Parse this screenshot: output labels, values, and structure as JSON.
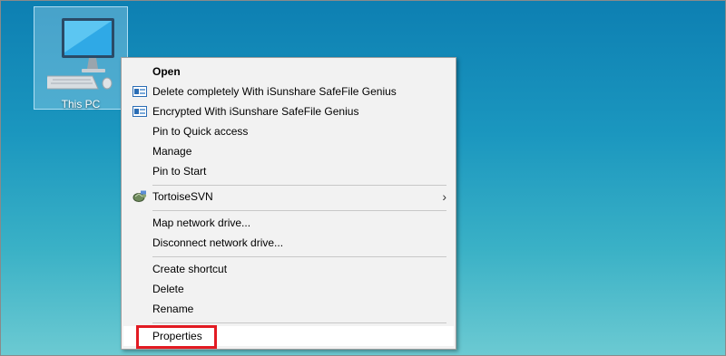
{
  "desktop": {
    "icon_label": "This PC",
    "icon_name": "computer-icon"
  },
  "context_menu": {
    "items": [
      {
        "label": "Open",
        "bold": true
      },
      {
        "label": "Delete completely With iSunshare SafeFile Genius",
        "icon": "isunshare-icon"
      },
      {
        "label": "Encrypted With iSunshare SafeFile Genius",
        "icon": "isunshare-icon"
      },
      {
        "label": "Pin to Quick access"
      },
      {
        "label": "Manage"
      },
      {
        "label": "Pin to Start"
      },
      {
        "label": "TortoiseSVN",
        "icon": "tortoisesvn-icon",
        "submenu": true
      },
      {
        "label": "Map network drive..."
      },
      {
        "label": "Disconnect network drive..."
      },
      {
        "label": "Create shortcut"
      },
      {
        "label": "Delete"
      },
      {
        "label": "Rename"
      },
      {
        "label": "Properties",
        "highlighted": true
      }
    ]
  },
  "colors": {
    "highlight_border": "#e21b23",
    "menu_background": "#f2f2f2"
  }
}
